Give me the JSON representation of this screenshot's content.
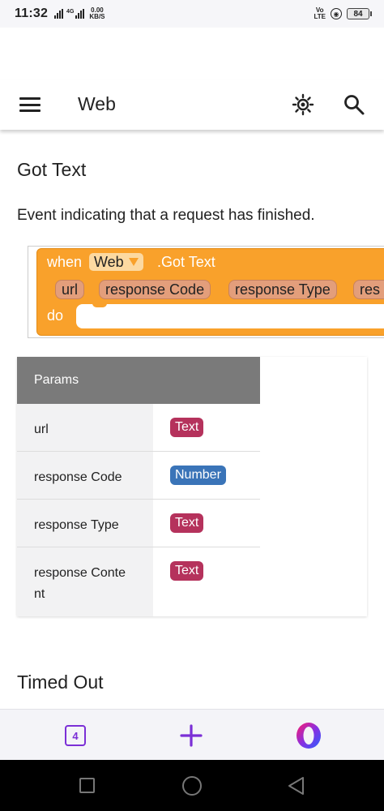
{
  "status_bar": {
    "time": "11:32",
    "network_label": "4G",
    "speed_value": "0.00",
    "speed_unit": "KB/S",
    "volte_top": "Vo",
    "volte_bottom": "LTE",
    "battery": "84"
  },
  "app_bar": {
    "title": "Web",
    "icons": [
      "menu-icon",
      "brightness-icon",
      "search-icon"
    ]
  },
  "section": {
    "title": "Got Text",
    "description": "Event indicating that a request has finished."
  },
  "block": {
    "when_label": "when",
    "component": "Web",
    "event": ".Got Text",
    "params": [
      "url",
      "response Code",
      "response Type",
      "res"
    ],
    "do_label": "do",
    "color": "#f9a12b"
  },
  "params_table": {
    "header": "Params",
    "rows": [
      {
        "name": "url",
        "type": "Text"
      },
      {
        "name": "response Code",
        "type": "Number"
      },
      {
        "name": "response Type",
        "type": "Text"
      },
      {
        "name_line1": "response Conte",
        "name_line2": "nt",
        "type": "Text"
      }
    ]
  },
  "next_section": {
    "title": "Timed Out"
  },
  "bottom_nav": {
    "tab_count": "4",
    "accent": "#7b2fd6"
  }
}
